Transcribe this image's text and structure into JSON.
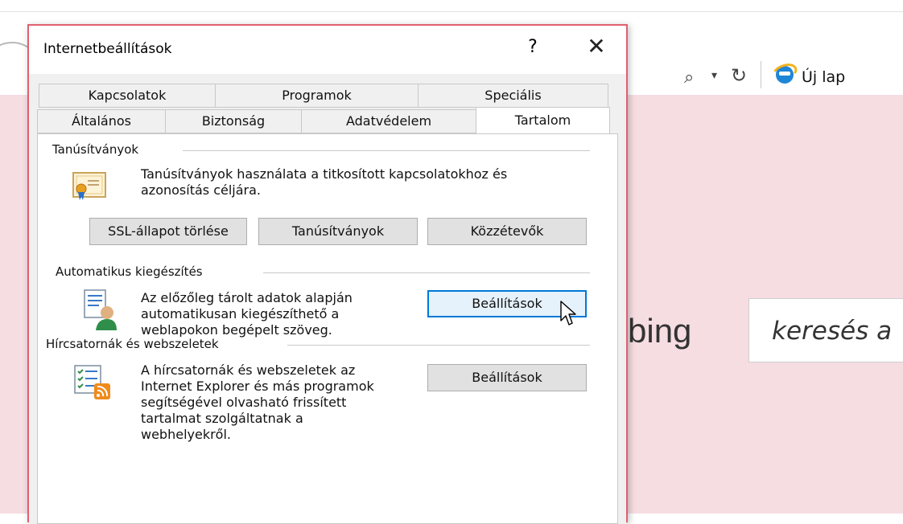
{
  "browser": {
    "tab_label": "Új lap",
    "bing_text": "bing",
    "search_placeholder": "keresés a"
  },
  "dialog": {
    "title": "Internetbeállítások",
    "help_glyph": "?",
    "close_glyph": "✕",
    "tabs_row1": [
      "Kapcsolatok",
      "Programok",
      "Speciális"
    ],
    "tabs_row2": [
      "Általános",
      "Biztonság",
      "Adatvédelem",
      "Tartalom"
    ],
    "selected_tab": "Tartalom",
    "certificates": {
      "group_label": "Tanúsítványok",
      "description_line1": "Tanúsítványok használata a titkosított kapcsolatokhoz és",
      "description_line2": "azonosítás céljára.",
      "buttons": [
        "SSL-állapot törlése",
        "Tanúsítványok",
        "Közzétevők"
      ]
    },
    "autocomplete": {
      "group_label": "Automatikus kiegészítés",
      "description_lines": [
        "Az előzőleg tárolt adatok alapján",
        "automatikusan kiegészíthető a",
        "weblapokon begépelt szöveg."
      ],
      "button": "Beállítások"
    },
    "feeds": {
      "group_label": "Hírcsatornák és webszeletek",
      "description_lines": [
        "A hírcsatornák és webszeletek az",
        "Internet Explorer és más programok",
        "segítségével olvasható frissített",
        "tartalmat szolgáltatnak a",
        "webhelyekről."
      ],
      "button": "Beállítások"
    }
  },
  "icons": {
    "address_search": "search-icon",
    "address_dropdown": "dropdown-arrow-icon",
    "address_refresh": "refresh-icon",
    "tab_favicon": "internet-explorer-icon",
    "certificates": "certificate-icon",
    "autocomplete": "autocomplete-user-icon",
    "feeds": "rss-feed-icon",
    "cursor": "mouse-pointer-icon"
  },
  "colors": {
    "dialog_border": "#e06070",
    "page_background": "#f6dde2",
    "focus_border": "#0078d7"
  }
}
